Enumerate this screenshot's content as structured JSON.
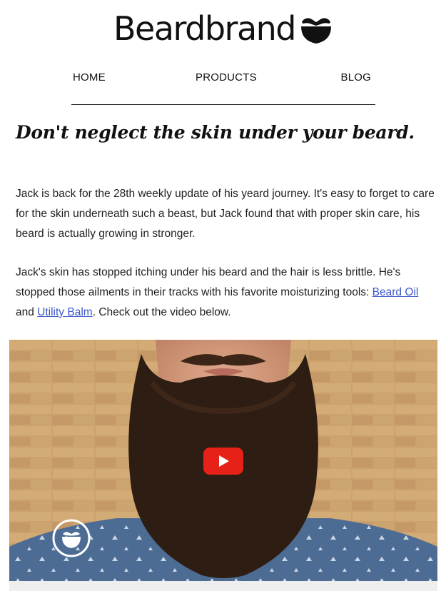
{
  "brand": {
    "name": "Beardbrand",
    "logo_icon": "beard-mustache-icon"
  },
  "nav": {
    "items": [
      {
        "label": "HOME"
      },
      {
        "label": "PRODUCTS"
      },
      {
        "label": "BLOG"
      }
    ]
  },
  "article": {
    "headline": "Don't neglect the skin under your beard.",
    "paragraph1": "Jack is back for the 28th weekly update of his yeard journey. It's easy to forget to care for the skin underneath such a beast, but Jack found that with proper skin care, his beard is actually growing in stronger.",
    "paragraph2_before": "Jack's skin has stopped itching under his beard and the hair is less brittle. He's stopped those ailments in their tracks with his favorite moisturizing tools: ",
    "link1": "Beard Oil",
    "paragraph2_between": " and ",
    "link2": "Utility Balm",
    "paragraph2_after": ". Check out the video below."
  },
  "video": {
    "play_icon": "youtube-play-icon",
    "watermark_icon": "beardbrand-badge-icon"
  },
  "colors": {
    "link": "#3b57c9",
    "play_button": "#e62117",
    "brick": "#c9a06a",
    "shirt": "#4b6a92",
    "beard": "#2e1d12"
  }
}
